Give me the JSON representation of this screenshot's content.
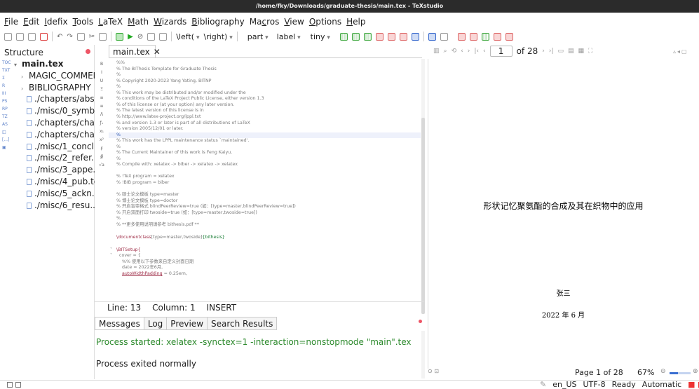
{
  "window": {
    "title": "/home/fky/Downloads/graduate-thesis/main.tex - TeXstudio"
  },
  "menu": [
    {
      "pre": "",
      "u": "F",
      "post": "ile"
    },
    {
      "pre": "",
      "u": "E",
      "post": "dit"
    },
    {
      "pre": "",
      "u": "I",
      "post": "defix"
    },
    {
      "pre": "",
      "u": "T",
      "post": "ools"
    },
    {
      "pre": "",
      "u": "L",
      "post": "aTeX"
    },
    {
      "pre": "",
      "u": "M",
      "post": "ath"
    },
    {
      "pre": "",
      "u": "W",
      "post": "izards"
    },
    {
      "pre": "",
      "u": "B",
      "post": "ibliography"
    },
    {
      "pre": "Ma",
      "u": "c",
      "post": "ros"
    },
    {
      "pre": "",
      "u": "V",
      "post": "iew"
    },
    {
      "pre": "",
      "u": "O",
      "post": "ptions"
    },
    {
      "pre": "",
      "u": "H",
      "post": "elp"
    }
  ],
  "toolbar": {
    "left_paren": "\\left(",
    "right_paren": "\\right)",
    "part": "part",
    "label": "label",
    "size": "tiny"
  },
  "structure": {
    "title": "Structure",
    "root": "main.tex",
    "groups": [
      "MAGIC_COMMEN...",
      "BIBLIOGRAPHY"
    ],
    "files": [
      "./chapters/abs...",
      "./misc/0_symb...",
      "./chapters/cha...",
      "./chapters/cha...",
      "./misc/1_concl...",
      "./misc/2_refer...",
      "./misc/3_appe...",
      "./misc/4_pub.tex",
      "./misc/5_ackn...",
      "./misc/6_resu..."
    ],
    "side_icons": [
      "TOC",
      "TXT",
      "Σ",
      "R",
      "III",
      "PS",
      "RP",
      "TZ",
      "AS",
      "◫",
      "[...]",
      "▣"
    ]
  },
  "editor": {
    "tab_label": "main.tex",
    "lines": [
      "%%",
      "% The BIThesis Template for Graduate Thesis",
      "%",
      "% Copyright 2020-2023 Yang Yating, BITNP",
      "%",
      "% This work may be distributed and/or modified under the",
      "% conditions of the LaTeX Project Public License, either version 1.3",
      "% of this license or (at your option) any later version.",
      "% The latest version of this license is in",
      "%   http://www.latex-project.org/lppl.txt",
      "% and version 1.3 or later is part of all distributions of LaTeX",
      "% version 2005/12/01 or later.",
      "%",
      "% This work has the LPPL maintenance status `maintained'.",
      "%",
      "% The Current Maintainer of this work is Feng Kaiyu.",
      "%",
      "% Compile with: xelatex -> biber -> xelatex -> xelatex",
      "",
      "% !TeX program = xelatex",
      "% !BIB program = biber",
      "",
      "% 硕士论文模板 type=master",
      "% 博士论文模板 type=doctor",
      "% 开启盲审格式 blindPeerReview=true (如：[type=master,blindPeerReview=true])",
      "% 开启双面打印 twoside=true (如：[type=master,twoside=true])",
      "%",
      "% **更多使用说明请参考 bithesis.pdf **",
      ""
    ],
    "docclass_cmd": "\\documentclass",
    "docclass_opts": "[type=master,twoside]",
    "docclass_arg": "{bithesis}",
    "setup_cmd": "\\BITSetup{",
    "cover_line": "cover = {",
    "comment_date": "%% 使用以下参数来自定义封面日期",
    "date_line": "date = 2022年6月,",
    "width_key": "autoWidthPadding",
    "width_val": " = 0.25em,",
    "side_icons": [
      "B",
      "I",
      "U",
      "Ξ",
      "≡",
      "≡",
      "ᐱ",
      "ƒₓ",
      "x₁",
      "x²",
      "∮",
      "∯",
      "√a"
    ]
  },
  "status": {
    "line": "Line: 13",
    "column": "Column: 1",
    "mode": "INSERT"
  },
  "messages": {
    "tabs": [
      "Messages",
      "Log",
      "Preview",
      "Search Results"
    ],
    "started": "Process started: xelatex -synctex=1 -interaction=nonstopmode \"main\".tex",
    "exited": "Process exited normally"
  },
  "pdf": {
    "page_current": "1",
    "page_total": "of 28",
    "title": "形状记忆聚氨酯的合成及其在织物中的应用",
    "author": "张三",
    "date": "2022 年 6 月",
    "page_status": "Page 1 of 28",
    "zoom": "67%"
  },
  "bottom": {
    "lang": "en_US",
    "encoding": "UTF-8",
    "state": "Ready",
    "mode": "Automatic"
  },
  "colors": {
    "title_bar": "#2b2b2b",
    "comment": "#7a7a7a",
    "command": "#a0304a",
    "keyword": "#1d7f38",
    "process_message": "#2d8a2d"
  }
}
